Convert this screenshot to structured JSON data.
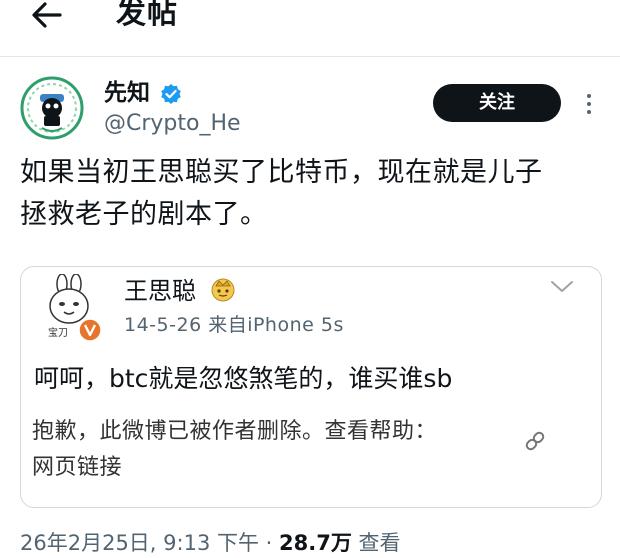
{
  "header": {
    "title": "发帖"
  },
  "author": {
    "name": "先知",
    "handle": "@Crypto_He",
    "follow_label": "关注"
  },
  "post": {
    "text_line1": "如果当初王思聪买了比特币，现在就是儿子",
    "text_line2": "拯救老子的剧本了。"
  },
  "quote": {
    "name": "王思聪",
    "avatar_caption": "宝刀",
    "meta": "14-5-26  来自iPhone 5s",
    "text": "呵呵，btc就是忽悠煞笔的，谁买谁sb",
    "notice_line1": "抱歉，此微博已被作者删除。查看帮助：",
    "notice_line2": "网页链接"
  },
  "footer": {
    "timestamp": "26年2月25日, 9:13 下午 · ",
    "views_count": "28.7万",
    "views_label": " 查看"
  },
  "colors": {
    "accent": "#1d9bf0",
    "text": "#0f1419",
    "secondary": "#536471",
    "avatar_ring": "#2e9e6a"
  },
  "icons": [
    "back-arrow-icon",
    "verified-badge-icon",
    "more-icon",
    "crown-emoji-icon",
    "chevron-down-icon",
    "link-icon",
    "v-badge-icon"
  ]
}
